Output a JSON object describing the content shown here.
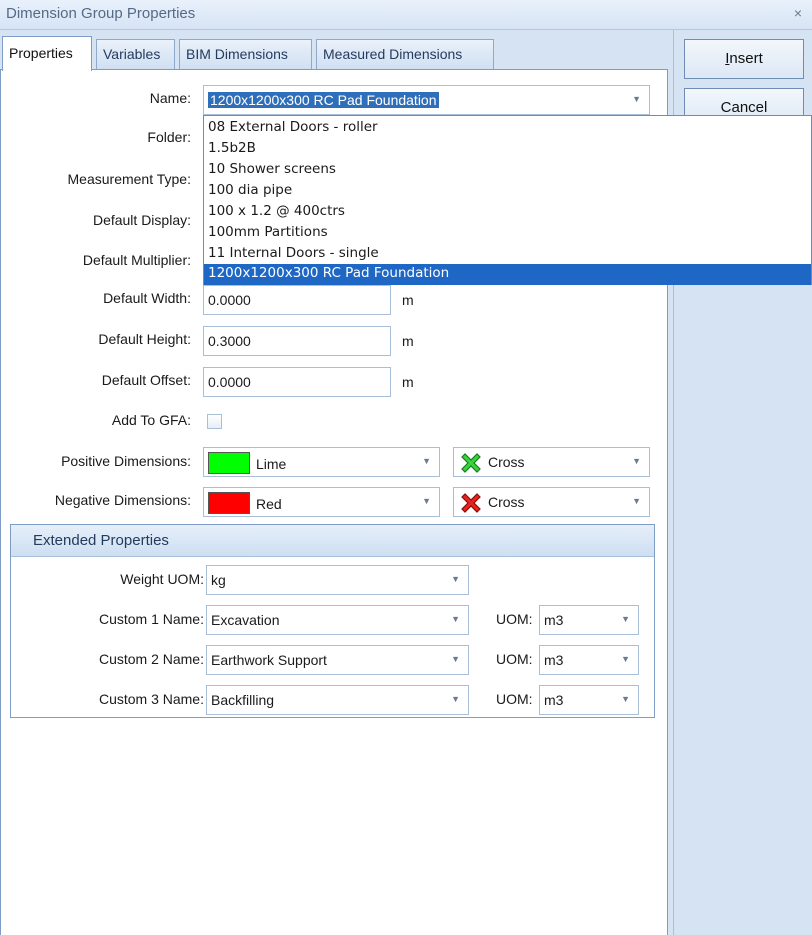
{
  "window": {
    "title": "Dimension Group Properties",
    "close_glyph": "×"
  },
  "tabs": [
    {
      "label": "Properties",
      "active": true
    },
    {
      "label": "Variables",
      "active": false
    },
    {
      "label": "BIM Dimensions",
      "active": false
    },
    {
      "label": "Measured Dimensions",
      "active": false
    }
  ],
  "buttons": {
    "insert_prefix": "I",
    "insert_rest": "nsert",
    "cancel": "Cancel"
  },
  "form": {
    "name_label": "Name:",
    "name_value": "1200x1200x300 RC Pad Foundation",
    "folder_label": "Folder:",
    "measurement_type_label": "Measurement Type:",
    "default_display_label": "Default Display:",
    "default_multiplier_label": "Default Multiplier:",
    "default_width_label": "Default Width:",
    "default_width_value": "0.0000",
    "default_width_unit": "m",
    "default_height_label": "Default Height:",
    "default_height_value": "0.3000",
    "default_height_unit": "m",
    "default_offset_label": "Default Offset:",
    "default_offset_value": "0.0000",
    "default_offset_unit": "m",
    "add_to_gfa_label": "Add To GFA:",
    "add_to_gfa_checked": false,
    "positive_label": "Positive Dimensions:",
    "positive_color_name": "Lime",
    "positive_color": "#00ff00",
    "positive_marker": "Cross",
    "negative_label": "Negative Dimensions:",
    "negative_color_name": "Red",
    "negative_color": "#ff0000",
    "negative_marker": "Cross"
  },
  "name_dropdown": {
    "items": [
      "08 External Doors - roller",
      "1.5b2B",
      "10 Shower screens",
      "100 dia pipe",
      "100 x 1.2 @ 400ctrs",
      "100mm Partitions",
      "11 Internal Doors - single",
      "1200x1200x300 RC Pad Foundation"
    ],
    "selected_index": 7
  },
  "extended": {
    "header": "Extended Properties",
    "weight_uom_label": "Weight UOM:",
    "weight_uom_value": "kg",
    "uom_label": "UOM:",
    "custom": [
      {
        "label": "Custom 1 Name:",
        "value": "Excavation",
        "uom": "m3"
      },
      {
        "label": "Custom 2 Name:",
        "value": "Earthwork Support",
        "uom": "m3"
      },
      {
        "label": "Custom 3 Name:",
        "value": "Backfilling",
        "uom": "m3"
      }
    ]
  },
  "icons": {
    "cross": "cross-icon",
    "dropdown_arrow": "chevron-down-icon",
    "close": "close-icon"
  },
  "colors": {
    "accent": "#2f6fb9",
    "selected_item": "#1e67c4",
    "chrome": "#d5e3f3"
  }
}
